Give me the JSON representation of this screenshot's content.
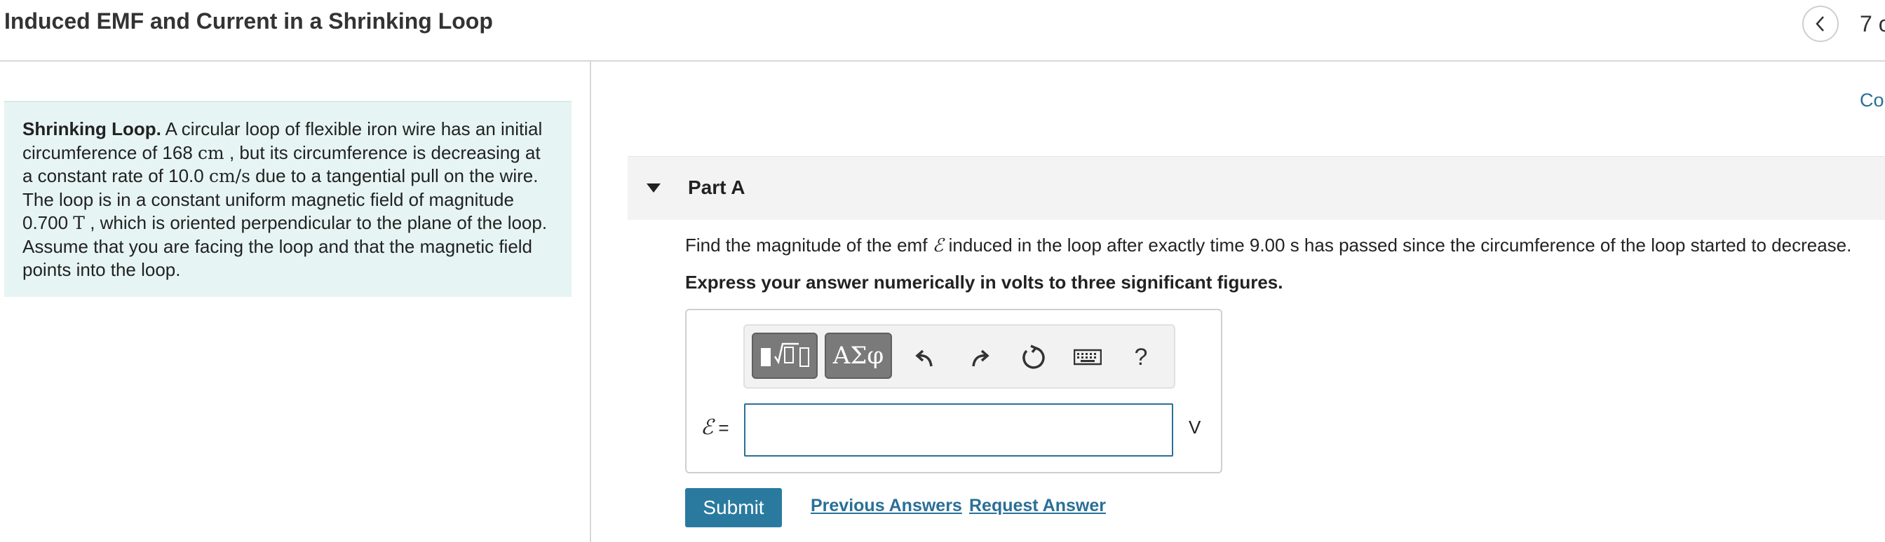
{
  "header": {
    "title": "Induced EMF and Current in a Shrinking Loop",
    "page_count": "7 o",
    "back_icon": "chevron-left-icon"
  },
  "problem": {
    "heading": "Shrinking Loop.",
    "text_1": " A circular loop of flexible iron wire has an initial circumference of 168 ",
    "unit_cm": "cm",
    "text_2": " , but its circumference is decreasing at a constant rate of 10.0 ",
    "unit_cm_s": "cm/s",
    "text_3": " due to a tangential pull on the wire. The loop is in a constant uniform magnetic field of magnitude 0.700 ",
    "unit_T": "T",
    "text_4": " , which is oriented perpendicular to the plane of the loop. Assume that you are facing the loop and that the magnetic field points into the loop."
  },
  "side_link": "Co",
  "part": {
    "title": "Part A",
    "question_before": "Find the magnitude of the emf ",
    "question_symbol": "ℰ",
    "question_after": " induced in the loop after exactly time 9.00 s has passed since the circumference of the loop started to decrease.",
    "instruction": "Express your answer numerically in volts to three significant figures."
  },
  "toolbar": {
    "templates_button": "templates",
    "greek_label": "ΑΣφ",
    "help_label": "?"
  },
  "answer": {
    "var_symbol": "ℰ",
    "equals": " =",
    "value": "",
    "unit": "V"
  },
  "actions": {
    "submit": "Submit",
    "previous": "Previous Answers",
    "request": "Request Answer"
  }
}
